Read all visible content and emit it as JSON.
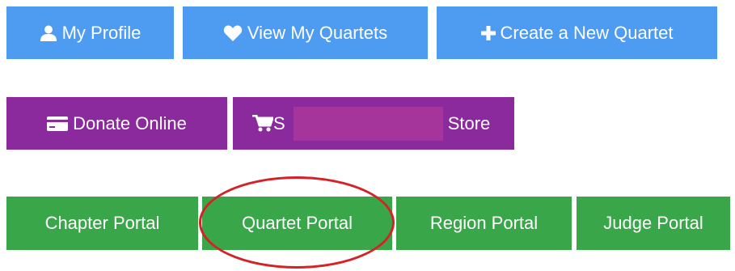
{
  "row1": {
    "profile_label": "My Profile",
    "view_label": "View My Quartets",
    "create_label": "Create a New Quartet"
  },
  "row2": {
    "donate_label": "Donate Online",
    "store_prefix": "S",
    "store_suffix": "Store"
  },
  "row3": {
    "chapter_label": "Chapter Portal",
    "quartet_label": "Quartet Portal",
    "region_label": "Region Portal",
    "judge_label": "Judge Portal"
  },
  "icons": {
    "profile": "user-icon",
    "view": "heart-icon",
    "create": "plus-icon",
    "donate": "credit-card-icon",
    "store": "shopping-cart-icon"
  },
  "colors": {
    "blue": "#4e9bf2",
    "purple": "#8a2a9c",
    "green": "#3aa64a",
    "highlight": "#d42226",
    "redaction": "#a5359a"
  }
}
